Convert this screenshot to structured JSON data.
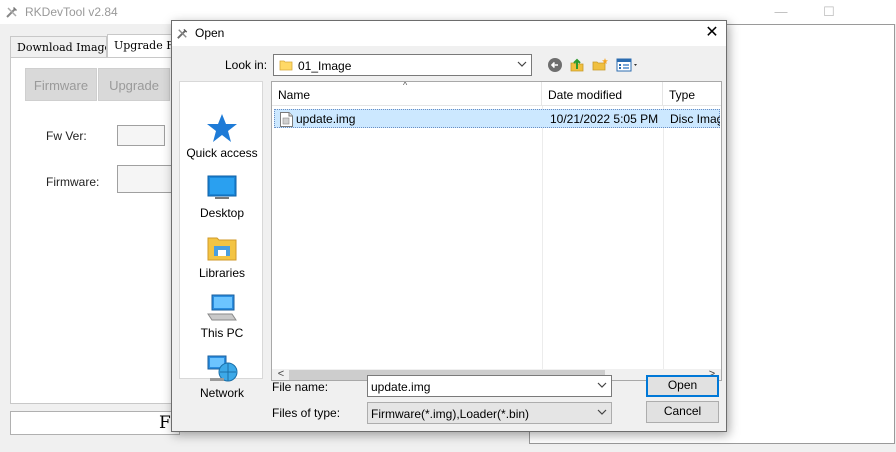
{
  "app": {
    "title": "RKDevTool v2.84",
    "window_buttons": {
      "minimize": "—",
      "maximize": "☐"
    },
    "tabs": [
      "Download Image",
      "Upgrade Fi"
    ],
    "buttons": [
      "Firmware",
      "Upgrade"
    ],
    "labels": {
      "fw_ver": "Fw Ver:",
      "firmware": "Firmware:"
    },
    "bottom_text": "F"
  },
  "dialog": {
    "title": "Open",
    "close_glyph": "✕",
    "look_in": {
      "label": "Look in:",
      "value": "01_Image"
    },
    "toolbar_icons": [
      "back-icon",
      "up-folder-icon",
      "new-folder-icon",
      "view-menu-icon"
    ],
    "places": [
      {
        "label": "Quick access",
        "icon": "star-icon"
      },
      {
        "label": "Desktop",
        "icon": "desktop-icon"
      },
      {
        "label": "Libraries",
        "icon": "libraries-icon"
      },
      {
        "label": "This PC",
        "icon": "computer-icon"
      },
      {
        "label": "Network",
        "icon": "network-icon"
      }
    ],
    "columns": [
      "Name",
      "Date modified",
      "Type"
    ],
    "files": [
      {
        "name": "update.img",
        "date_modified": "10/21/2022 5:05 PM",
        "type": "Disc Image File"
      }
    ],
    "scroll": {
      "left": "<",
      "right": ">"
    },
    "file_name": {
      "label": "File name:",
      "value": "update.img"
    },
    "file_type": {
      "label": "Files of type:",
      "value": "Firmware(*.img),Loader(*.bin)"
    },
    "buttons": {
      "open": "Open",
      "cancel": "Cancel"
    }
  },
  "colors": {
    "selection": "#cce8ff",
    "accent": "#0078d7",
    "folder": "#ffd966"
  }
}
